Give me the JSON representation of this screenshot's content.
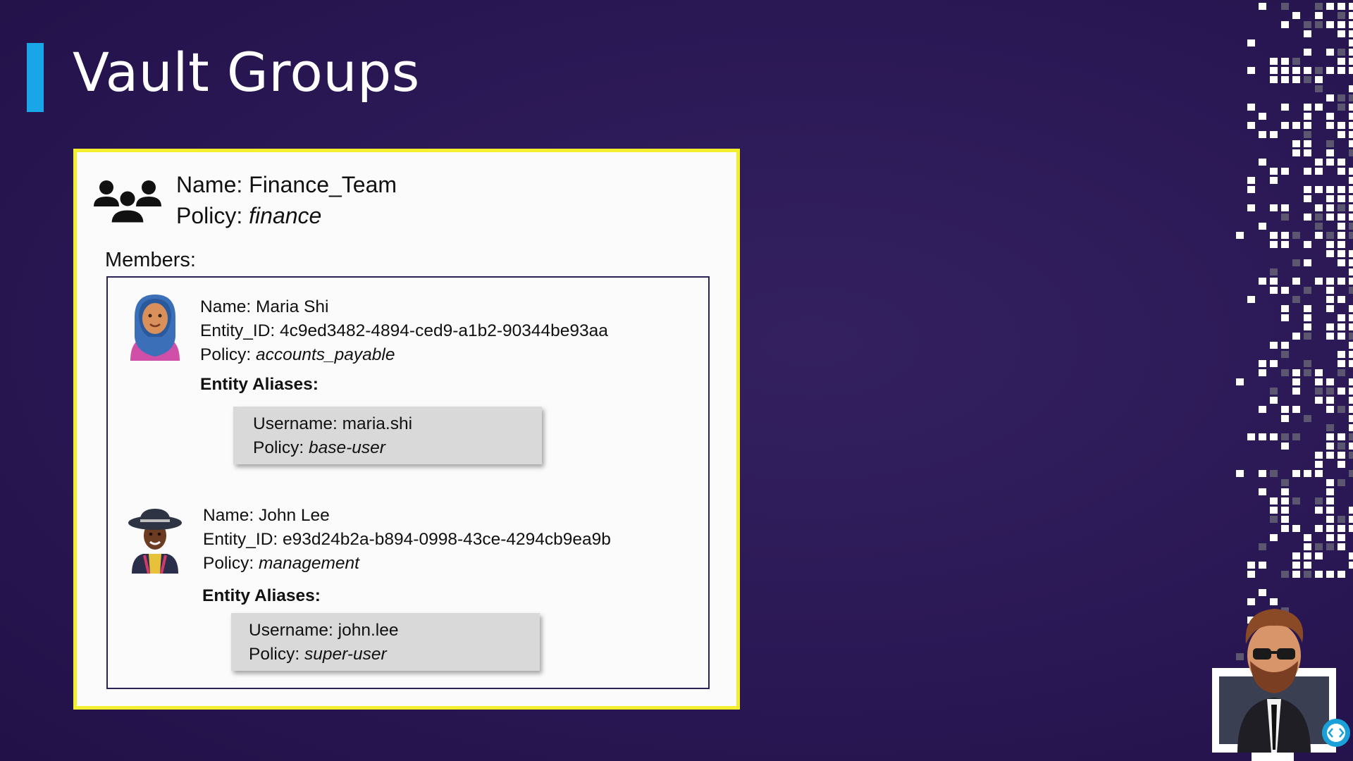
{
  "slide": {
    "title": "Vault Groups"
  },
  "group": {
    "name_prefix": "Name: ",
    "name": "Finance_Team",
    "policy_prefix": "Policy: ",
    "policy": "finance",
    "members_label": "Members:"
  },
  "members": [
    {
      "name_line": "Name: Maria Shi",
      "entity_line": "Entity_ID: 4c9ed3482-4894-ced9-a1b2-90344be93aa",
      "policy_prefix": "Policy: ",
      "policy": "accounts_payable",
      "aliases_label": "Entity Aliases:",
      "alias_username_line": "Username: maria.shi",
      "alias_policy_prefix": "Policy: ",
      "alias_policy": "base-user"
    },
    {
      "name_line": "Name: John Lee",
      "entity_line": "Entity_ID: e93d24b2a-b894-0998-43ce-4294cb9ea9b",
      "policy_prefix": "Policy: ",
      "policy": "management",
      "aliases_label": "Entity Aliases:",
      "alias_username_line": "Username: john.lee",
      "alias_policy_prefix": "Policy: ",
      "alias_policy": "super-user"
    }
  ],
  "icons": {
    "group": "group-users-icon",
    "member1": "avatar-woman-hijab",
    "member2": "avatar-man-hat",
    "presenter": "presenter-avatar"
  },
  "colors": {
    "background": "#2a1855",
    "title_accent": "#18a6e8",
    "card_border": "#f3ef2f",
    "alias_box": "#d9d9d9"
  }
}
